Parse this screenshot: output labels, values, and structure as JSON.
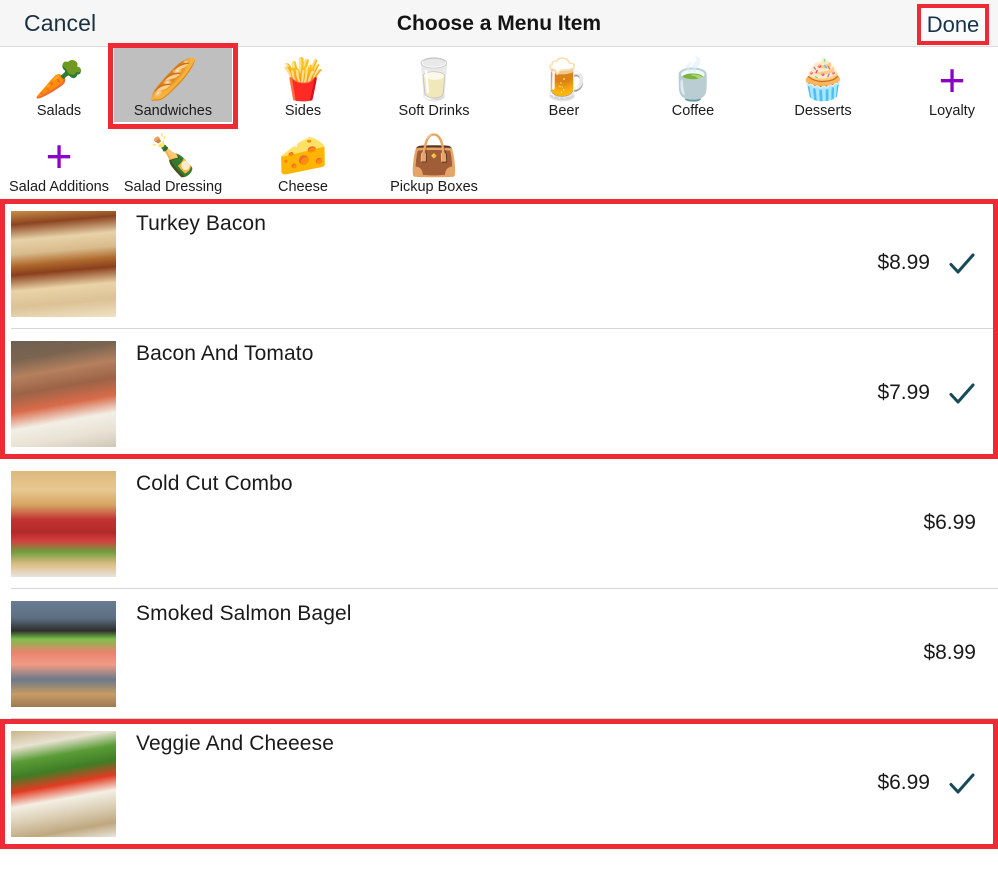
{
  "navbar": {
    "cancel_label": "Cancel",
    "title": "Choose a Menu Item",
    "done_label": "Done"
  },
  "colors": {
    "highlight": "#ee2b34",
    "checkmark": "#174a5a",
    "nav_text": "#18303f",
    "selected_tab_bg": "#bfbfbf",
    "separator": "#d6d6d6"
  },
  "categories": [
    {
      "label": "Salads",
      "icon": "carrot-icon",
      "glyph": "🥕",
      "selected": false,
      "highlighted": false
    },
    {
      "label": "Sandwiches",
      "icon": "bread-icon",
      "glyph": "🥖",
      "selected": true,
      "highlighted": true
    },
    {
      "label": "Sides",
      "icon": "fries-icon",
      "glyph": "🍟",
      "selected": false,
      "highlighted": false
    },
    {
      "label": "Soft Drinks",
      "icon": "milk-bottle-icon",
      "glyph": "🥛",
      "selected": false,
      "highlighted": false
    },
    {
      "label": "Beer",
      "icon": "beer-icon",
      "glyph": "🍺",
      "selected": false,
      "highlighted": false
    },
    {
      "label": "Coffee",
      "icon": "teacup-icon",
      "glyph": "🍵",
      "selected": false,
      "highlighted": false
    },
    {
      "label": "Desserts",
      "icon": "cupcake-icon",
      "glyph": "🧁",
      "selected": false,
      "highlighted": false
    },
    {
      "label": "Loyalty",
      "icon": "plus-icon",
      "glyph": "+",
      "selected": false,
      "highlighted": false
    },
    {
      "label": "Salad Additions",
      "icon": "plus-icon",
      "glyph": "+",
      "selected": false,
      "highlighted": false
    },
    {
      "label": "Salad Dressing",
      "icon": "bottle-icon",
      "glyph": "🍾",
      "selected": false,
      "highlighted": false
    },
    {
      "label": "Cheese",
      "icon": "cheese-icon",
      "glyph": "🧀",
      "selected": false,
      "highlighted": false
    },
    {
      "label": "Pickup  Boxes",
      "icon": "shopping-bag-icon",
      "glyph": "👜",
      "selected": false,
      "highlighted": false
    }
  ],
  "menu_items": [
    {
      "name": "Turkey Bacon",
      "price": "$8.99",
      "selected": true,
      "thumb": "turkey-bacon-sandwich-photo"
    },
    {
      "name": "Bacon And Tomato",
      "price": "$7.99",
      "selected": true,
      "thumb": "bacon-and-tomato-sandwich-photo"
    },
    {
      "name": "Cold Cut Combo",
      "price": "$6.99",
      "selected": false,
      "thumb": "cold-cut-combo-sandwich-photo"
    },
    {
      "name": "Smoked Salmon Bagel",
      "price": "$8.99",
      "selected": false,
      "thumb": "smoked-salmon-bagel-photo"
    },
    {
      "name": "Veggie And Cheeese",
      "price": "$6.99",
      "selected": true,
      "thumb": "veggie-and-cheese-sandwich-photo"
    }
  ],
  "highlight_groups": [
    {
      "from_item": 0,
      "to_item": 1
    },
    {
      "from_item": 4,
      "to_item": 4
    }
  ]
}
